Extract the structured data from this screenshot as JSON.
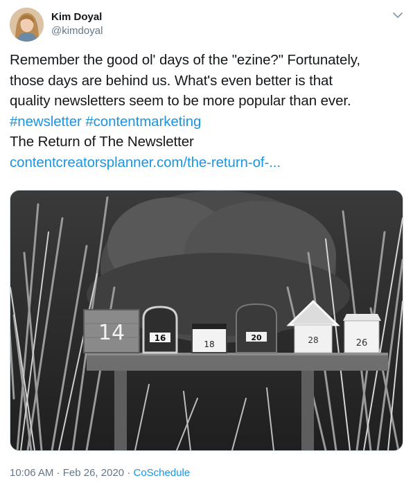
{
  "author": {
    "display_name": "Kim Doyal",
    "handle": "@kimdoyal"
  },
  "tweet": {
    "lines": [
      "Remember the good ol' days of the \"ezine?\" Fortunately,",
      "those days are behind us. What's even better is that",
      "quality newsletters seem to be more popular than ever."
    ],
    "hashtags": [
      "#newsletter",
      "#contentmarketing"
    ],
    "link_title": "The Return of The Newsletter",
    "link_url": "contentcreatorsplanner.com/the-return-of-..."
  },
  "media": {
    "mailbox_numbers": [
      "14",
      "16",
      "18",
      "20",
      "28",
      "26"
    ]
  },
  "footer": {
    "time": "10:06 AM",
    "separator": "·",
    "date": "Feb 26, 2020",
    "source": "CoSchedule"
  },
  "colors": {
    "link": "#1b95e0",
    "text": "#14171a",
    "secondary": "#657786"
  },
  "icons": {
    "caret": "chevron-down-icon"
  }
}
